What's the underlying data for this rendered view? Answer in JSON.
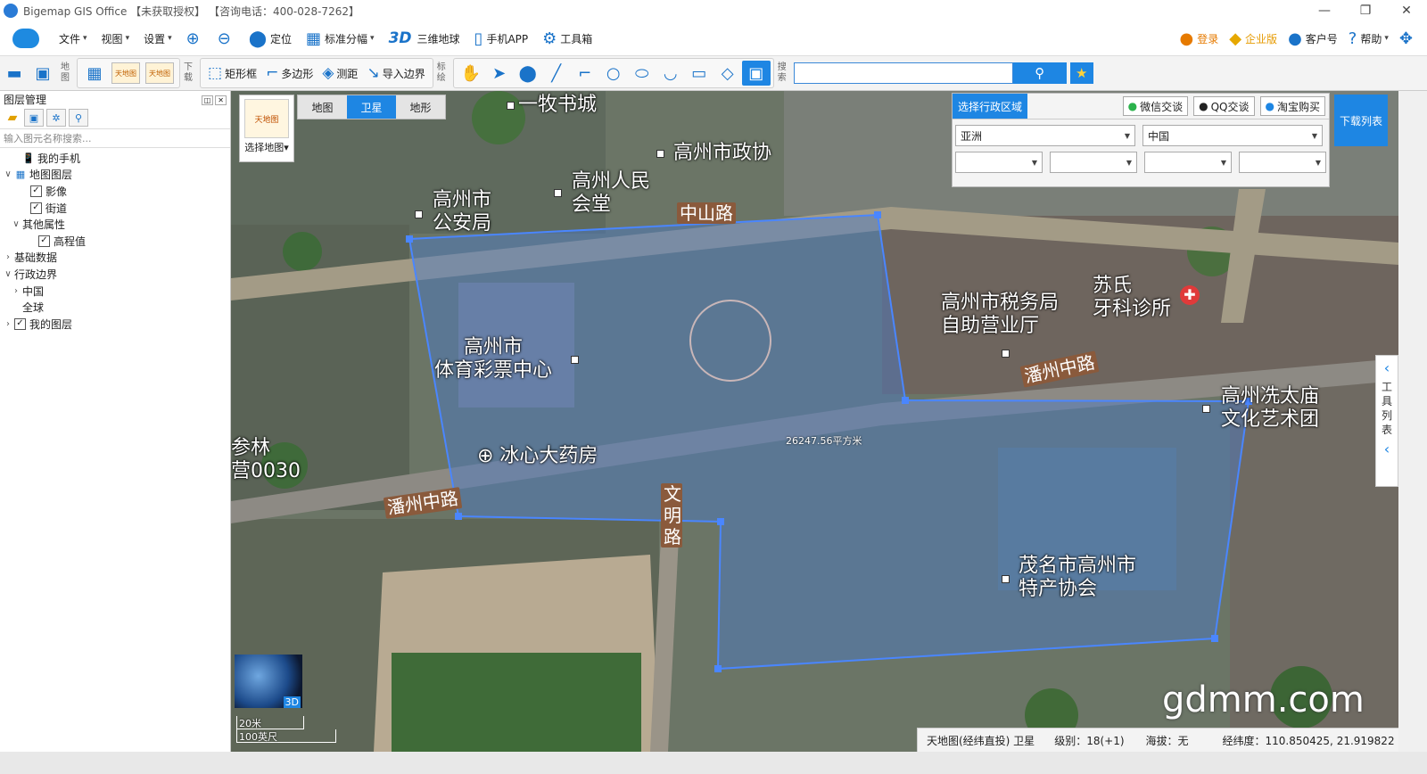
{
  "window": {
    "title": "Bigemap GIS Office 【未获取授权】 【咨询电话：400-028-7262】",
    "minimize": "—",
    "restore": "❐",
    "close": "✕"
  },
  "menu": {
    "items": [
      {
        "label": "文件",
        "caret": true
      },
      {
        "label": "视图",
        "caret": true
      },
      {
        "label": "设置",
        "caret": true
      }
    ],
    "zoom_in_icon": "⊕",
    "zoom_out_icon": "⊖",
    "locate": "定位",
    "standard_grid": "标准分幅",
    "threed_mark": "3D",
    "threed_globe": "三维地球",
    "mobile_app": "手机APP",
    "toolbox": "工具箱",
    "right": {
      "login": "登录",
      "enterprise": "企业版",
      "customer": "客户号",
      "help": "帮助"
    }
  },
  "toolbar": {
    "map_label": "地图",
    "download_label": "下载",
    "rect_frame": "矩形框",
    "polygon": "多边形",
    "measure": "测距",
    "import_boundary": "导入边界",
    "annotate_label": "标绘",
    "search_label": "搜索",
    "search_placeholder": "",
    "mapworld_thumb": "天地图"
  },
  "layers": {
    "title": "图层管理",
    "search_placeholder": "输入图元名称搜索...",
    "tree": [
      {
        "label": "我的手机",
        "level": 1,
        "exp": "",
        "checkbox": false,
        "icon": "📱"
      },
      {
        "label": "地图图层",
        "level": 0,
        "exp": "∨",
        "checkbox": false,
        "icon": "▦"
      },
      {
        "label": "影像",
        "level": 2,
        "exp": "",
        "checkbox": true,
        "icon": ""
      },
      {
        "label": "街道",
        "level": 2,
        "exp": "",
        "checkbox": true,
        "icon": ""
      },
      {
        "label": "其他属性",
        "level": 1,
        "exp": "∨",
        "checkbox": false,
        "icon": ""
      },
      {
        "label": "高程值",
        "level": 3,
        "exp": "",
        "checkbox": true,
        "icon": ""
      },
      {
        "label": "基础数据",
        "level": 0,
        "exp": "›",
        "checkbox": false,
        "icon": ""
      },
      {
        "label": "行政边界",
        "level": 0,
        "exp": "∨",
        "checkbox": false,
        "icon": ""
      },
      {
        "label": "中国",
        "level": 1,
        "exp": "›",
        "checkbox": false,
        "icon": ""
      },
      {
        "label": "全球",
        "level": 1,
        "exp": "",
        "checkbox": false,
        "icon": ""
      },
      {
        "label": "我的图层",
        "level": 0,
        "exp": "›",
        "checkbox": true,
        "icon": ""
      }
    ]
  },
  "map": {
    "select_map": "选择地图",
    "tabs": [
      {
        "label": "地图",
        "active": false
      },
      {
        "label": "卫星",
        "active": true
      },
      {
        "label": "地形",
        "active": false
      }
    ],
    "region": {
      "title": "选择行政区域",
      "wechat": "微信交谈",
      "qq": "QQ交谈",
      "taobao": "淘宝购买",
      "continent": "亚洲",
      "country": "中国"
    },
    "download_list": "下载列表",
    "side_tools": "工具列表",
    "labels": {
      "bookstore": "一牧书城",
      "cppcc": "高州市政协",
      "police": "高州市\n公安局",
      "hall": "高州人民\n会堂",
      "zhongshan": "中山路",
      "tax": "高州市税务局\n自助营业厅",
      "dental": "苏氏\n牙科诊所",
      "lottery": "高州市\n体育彩票中心",
      "panzhou_mid": "潘州中路",
      "panzhou_left": "潘州中路",
      "temple": "高州冼太庙\n文化艺术团",
      "pharmacy": "⊕ 冰心大药房",
      "camp": "参林\n营0030",
      "wenming": "文\n明\n路",
      "specialty": "茂名市高州市\n特产协会"
    },
    "area": "26247.56平方米",
    "scale_20m": "20米",
    "scale_100ft": "100英尺",
    "globe_3d": "3D",
    "watermark": "gdmm.com"
  },
  "status": {
    "source": "天地图(经纬直投) 卫星",
    "level": "级别：18(+1)",
    "elevation": "海拔：无",
    "coords": "经纬度：110.850425, 21.919822"
  }
}
